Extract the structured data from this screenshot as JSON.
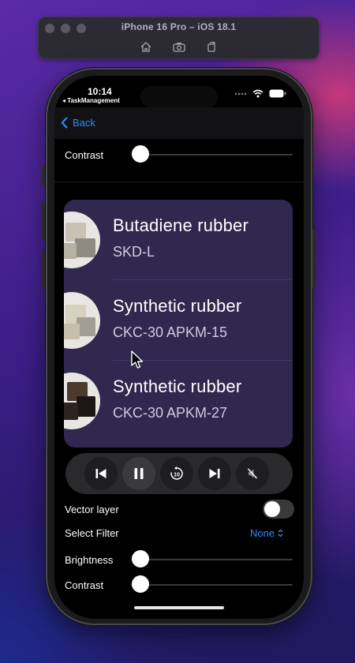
{
  "simulator": {
    "title": "iPhone 16 Pro – iOS 18.1",
    "tools": [
      "home-icon",
      "screenshot-icon",
      "rotate-icon"
    ]
  },
  "status": {
    "time": "10:14",
    "back_app": "◂ TaskManagement"
  },
  "nav": {
    "back_label": "Back"
  },
  "controls_top": {
    "contrast_label": "Contrast",
    "contrast_value": 0
  },
  "materials": [
    {
      "title": "Butadiene rubber",
      "subtitle": "SKD-L"
    },
    {
      "title": "Synthetic rubber",
      "subtitle": "CKC-30 APKM-15"
    },
    {
      "title": "Synthetic rubber",
      "subtitle": "CKC-30 APKM-27"
    }
  ],
  "player": {
    "buttons": [
      "skip-back-icon",
      "pause-icon",
      "replay-10-icon",
      "skip-forward-icon",
      "mute-icon"
    ],
    "replay_seconds": "10"
  },
  "settings": {
    "vector_layer_label": "Vector layer",
    "vector_layer_on": false,
    "select_filter_label": "Select Filter",
    "select_filter_value": "None",
    "brightness_label": "Brightness",
    "brightness_value": 0,
    "contrast_label": "Contrast",
    "contrast_value": 0
  },
  "colors": {
    "accent": "#2f8cff",
    "card": "#30284f",
    "background": "#000000"
  }
}
